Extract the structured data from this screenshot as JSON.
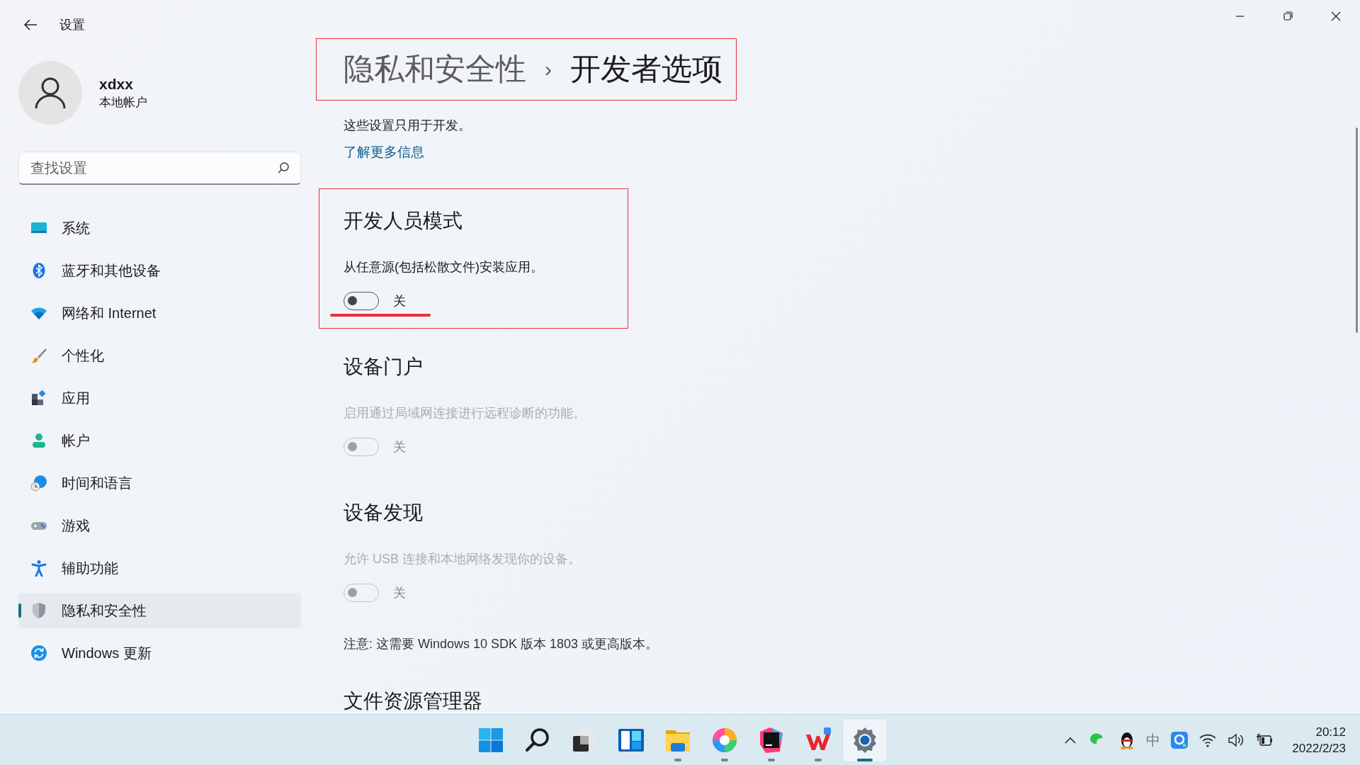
{
  "window": {
    "title": "设置"
  },
  "account": {
    "name": "xdxx",
    "type": "本地帐户"
  },
  "search": {
    "placeholder": "查找设置"
  },
  "sidebar": {
    "items": [
      {
        "label": "系统",
        "kind": "system",
        "selected": false
      },
      {
        "label": "蓝牙和其他设备",
        "kind": "bluetooth",
        "selected": false
      },
      {
        "label": "网络和 Internet",
        "kind": "network",
        "selected": false
      },
      {
        "label": "个性化",
        "kind": "brush",
        "selected": false
      },
      {
        "label": "应用",
        "kind": "apps",
        "selected": false
      },
      {
        "label": "帐户",
        "kind": "account",
        "selected": false
      },
      {
        "label": "时间和语言",
        "kind": "time",
        "selected": false
      },
      {
        "label": "游戏",
        "kind": "gaming",
        "selected": false
      },
      {
        "label": "辅助功能",
        "kind": "accessibility",
        "selected": false
      },
      {
        "label": "隐私和安全性",
        "kind": "privacy",
        "selected": true
      },
      {
        "label": "Windows 更新",
        "kind": "update",
        "selected": false
      }
    ]
  },
  "breadcrumb": {
    "parent": "隐私和安全性",
    "separator": "›",
    "current": "开发者选项",
    "annotated": true
  },
  "intro": "这些设置只用于开发。",
  "link": "了解更多信息",
  "sections": [
    {
      "title": "开发人员模式",
      "description": "从任意源(包括松散文件)安装应用。",
      "toggle": {
        "on": false,
        "label": "关"
      },
      "disabled": false,
      "annotated": true
    },
    {
      "title": "设备门户",
      "description": "启用通过局域网连接进行远程诊断的功能。",
      "toggle": {
        "on": false,
        "label": "关"
      },
      "disabled": true,
      "annotated": false
    },
    {
      "title": "设备发现",
      "description": "允许 USB 连接和本地网络发现你的设备。",
      "toggle": {
        "on": false,
        "label": "关"
      },
      "disabled": true,
      "annotated": false
    }
  ],
  "note": "注意: 这需要 Windows 10 SDK 版本 1803 或更高版本。",
  "next_section_title": "文件资源管理器",
  "taskbar": {
    "apps": [
      {
        "kind": "start",
        "running": false,
        "active": false
      },
      {
        "kind": "search",
        "running": false,
        "active": false
      },
      {
        "kind": "taskview",
        "running": false,
        "active": false
      },
      {
        "kind": "widgets",
        "running": false,
        "active": false
      },
      {
        "kind": "folder",
        "running": true,
        "active": false
      },
      {
        "kind": "swirl",
        "running": true,
        "active": false
      },
      {
        "kind": "ide",
        "running": true,
        "active": false
      },
      {
        "kind": "office",
        "running": true,
        "active": false
      },
      {
        "kind": "settings",
        "running": true,
        "active": true
      }
    ]
  },
  "tray": {
    "ime": "中",
    "time": "20:12",
    "date": "2022/2/23"
  }
}
